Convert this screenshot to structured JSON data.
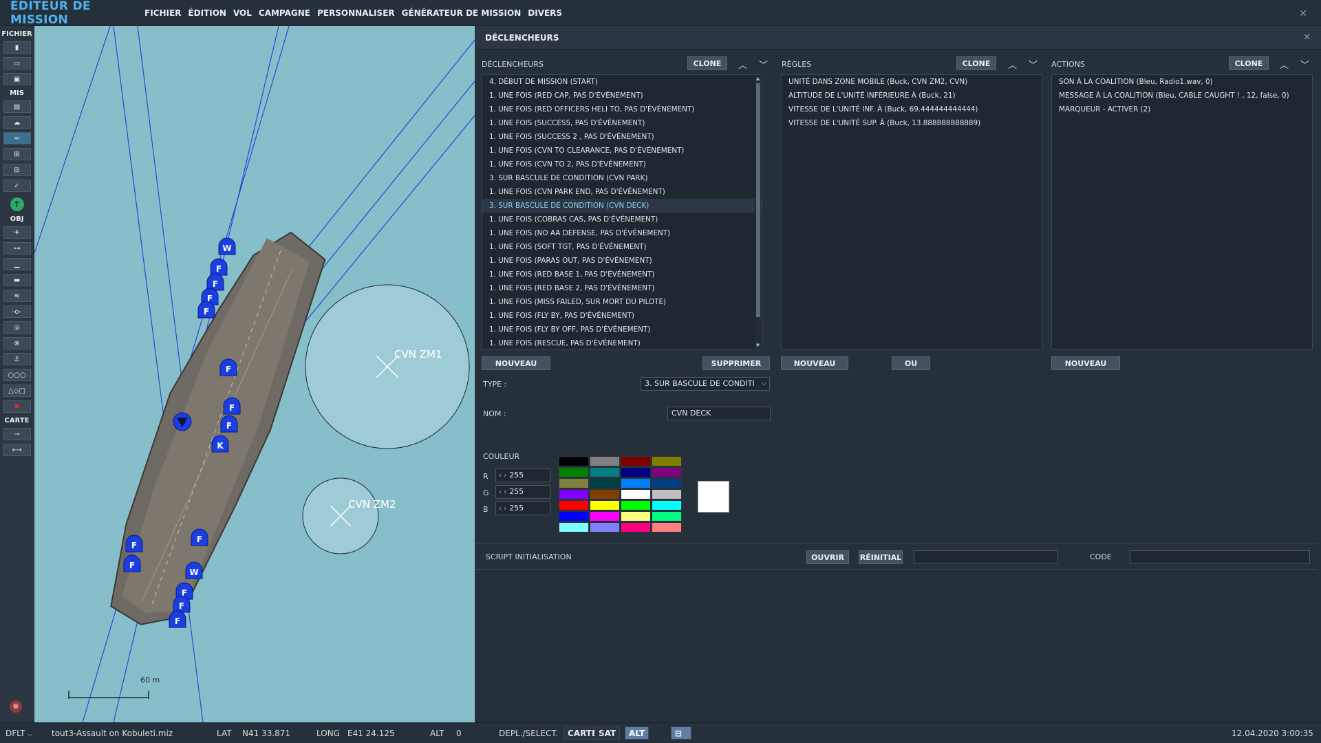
{
  "app": {
    "title": "ÉDITEUR DE MISSION",
    "menu": [
      "FICHIER",
      "ÉDITION",
      "VOL",
      "CAMPAGNE",
      "PERSONNALISER",
      "GÉNÉRATEUR DE MISSION",
      "DIVERS"
    ],
    "close_glyph": "✕"
  },
  "toolbar": {
    "sections": {
      "fichier": "FICHIER",
      "mis": "MIS",
      "obj": "OBJ",
      "carte": "CARTE"
    },
    "fichier_icons": [
      "new-file-icon",
      "open-folder-icon",
      "save-icon"
    ],
    "mis_icons": [
      "briefing-icon",
      "weather-icon",
      "aircraft-group-icon",
      "triggers-icon",
      "goals-icon",
      "checkmark-icon",
      "coalition-icon"
    ],
    "obj_icons": [
      "plane-icon",
      "helicopter-icon",
      "ship-icon",
      "vehicle-icon",
      "armor-icon",
      "static-object-icon",
      "target-icon",
      "airbase-icon",
      "naval-icon",
      "template-icon",
      "shapes-icon",
      "delete-icon"
    ],
    "carte_icons": [
      "map-key-icon",
      "ruler-icon"
    ]
  },
  "map": {
    "zones": [
      {
        "label": "CVN ZM1"
      },
      {
        "label": "CVN ZM2"
      }
    ],
    "unit_letters": [
      "W",
      "F",
      "F",
      "F",
      "F",
      "F",
      "F",
      "F",
      "K",
      "F",
      "F",
      "F",
      "W",
      "F",
      "F",
      "F"
    ],
    "scale_label": "60 m",
    "colors": {
      "water": "#86bfc9",
      "zone_fill": "#9fcbd6",
      "unit": "#1a3ee0",
      "route": "#2a46d8"
    }
  },
  "panel": {
    "title": "DÉCLENCHEURS",
    "close_glyph": "✕",
    "triggers": {
      "label": "DÉCLENCHEURS",
      "clone": "CLONE",
      "items": [
        "4. DÉBUT DE MISSION (START)",
        "1. UNE FOIS (RED CAP, PAS D'ÉVÉNEMENT)",
        "1. UNE FOIS (RED OFFICERS HELI TO, PAS D'ÉVÉNEMENT)",
        "1. UNE FOIS (SUCCESS, PAS D'ÉVÉNEMENT)",
        "1. UNE FOIS (SUCCESS 2 , PAS D'ÉVÉNEMENT)",
        "1. UNE FOIS (CVN TO CLEARANCE, PAS D'ÉVÉNEMENT)",
        "1. UNE FOIS (CVN TO 2, PAS D'ÉVÉNEMENT)",
        "3. SUR BASCULE DE CONDITION (CVN PARK)",
        "1. UNE FOIS (CVN PARK END, PAS D'ÉVÉNEMENT)",
        "3. SUR BASCULE DE CONDITION (CVN DECK)",
        "1. UNE FOIS (COBRAS CAS, PAS D'ÉVÉNEMENT)",
        "1. UNE FOIS (NO AA DEFENSE, PAS D'ÉVÉNEMENT)",
        "1. UNE FOIS (SOFT TGT, PAS D'ÉVÉNEMENT)",
        "1. UNE FOIS (PARAS OUT, PAS D'ÉVÉNEMENT)",
        "1. UNE FOIS (RED BASE 1, PAS D'ÉVÉNEMENT)",
        "1. UNE FOIS (RED BASE 2, PAS D'ÉVÉNEMENT)",
        "1. UNE FOIS (MISS FAILED, SUR MORT DU PILOTE)",
        "1. UNE FOIS (FLY BY, PAS D'ÉVÉNEMENT)",
        "1. UNE FOIS (FLY BY OFF, PAS D'ÉVÉNEMENT)",
        "1. UNE FOIS (RESCUE, PAS D'ÉVÉNEMENT)"
      ],
      "selected_index": 9,
      "new_btn": "NOUVEAU",
      "delete_btn": "SUPPRIMER"
    },
    "rules": {
      "label": "RÈGLES",
      "clone": "CLONE",
      "items": [
        "UNITÉ DANS ZONE MOBILE (Buck, CVN ZM2, CVN)",
        "ALTITUDE DE L'UNITÉ INFÉRIEURE À (Buck, 21)",
        "VITESSE DE L'UNITÉ INF. À (Buck, 69.444444444444)",
        "VITESSE DE L'UNITÉ SUP. À (Buck, 13.888888888889)"
      ],
      "new_btn": "NOUVEAU",
      "or_btn": "OU"
    },
    "actions": {
      "label": "ACTIONS",
      "clone": "CLONE",
      "items": [
        "SON À LA COALITION (Bleu, Radio1.wav, 0)",
        "MESSAGE À LA COALITION (Bleu, CABLE CAUGHT ! , 12, false, 0)",
        "MARQUEUR - ACTIVER (2)"
      ],
      "new_btn": "NOUVEAU"
    },
    "form": {
      "type_label": "TYPE :",
      "type_value": "3. SUR BASCULE DE CONDITI",
      "name_label": "NOM :",
      "name_value": "CVN DECK",
      "color_label": "COULEUR",
      "r_label": "R",
      "g_label": "G",
      "b_label": "B",
      "r_value": "255",
      "g_value": "255",
      "b_value": "255",
      "palette": [
        "#000000",
        "#808080",
        "#800000",
        "#808000",
        "#008000",
        "#008080",
        "#000080",
        "#800080",
        "#808040",
        "#004040",
        "#0080ff",
        "#004080",
        "#8000ff",
        "#804000",
        "#ffffff",
        "#c0c0c0",
        "#ff0000",
        "#ffff00",
        "#00ff00",
        "#00ffff",
        "#0000ff",
        "#ff00ff",
        "#ffff80",
        "#00ff80",
        "#80ffff",
        "#8080ff",
        "#ff0080",
        "#ff8080"
      ],
      "preview_color": "#ffffff"
    },
    "script": {
      "label": "SCRIPT INITIALISATION",
      "open_btn": "OUVRIR",
      "reset_btn": "RÉINITIAL",
      "code_label": "CODE"
    }
  },
  "status": {
    "profile": "DFLT",
    "mission_file": "tout3-Assault on Kobuleti.miz",
    "lat_label": "LAT",
    "lat_value": "N41 33.871",
    "long_label": "LONG",
    "long_value": "E41 24.125",
    "alt_label": "ALT",
    "alt_value": "0",
    "move_select": "DEPL./SELECT.",
    "carte": "CARTE",
    "sat": "SAT",
    "alt_btn": "ALT",
    "datetime": "12.04.2020 3:00:35"
  }
}
